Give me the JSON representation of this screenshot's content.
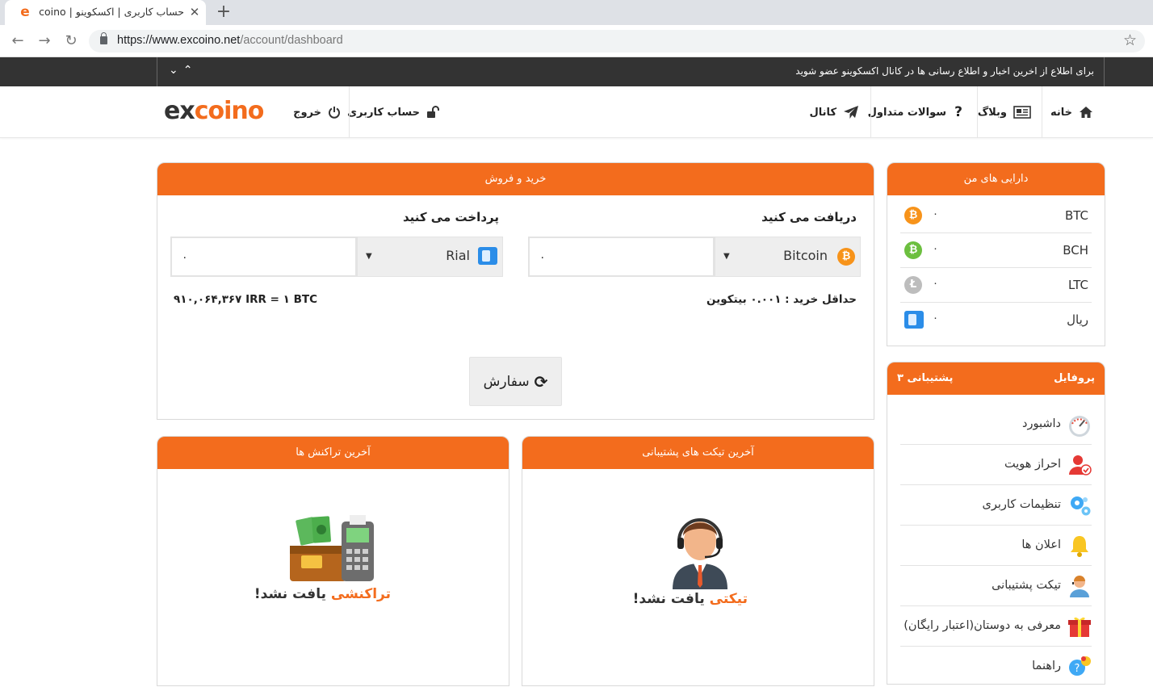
{
  "browser": {
    "tab_title": "حساب کاربری | اکسکوینو | excoino",
    "favicon": "e",
    "url_host": "https://www.excoino.net",
    "url_path": "/account/dashboard"
  },
  "notice": {
    "text": "برای اطلاع از اخرین اخبار و اطلاع رسانی ها در کانال اکسکوینو عضو شوید"
  },
  "nav": {
    "home": "خانه",
    "blog": "وبلاگ",
    "faq": "سوالات متداول",
    "channel": "کانال",
    "account": "حساب کاربری",
    "logout": "خروج",
    "logo_ex": "ex",
    "logo_coin": "coino"
  },
  "trade": {
    "title": "خرید و فروش",
    "receive_title": "دریافت می کنید",
    "pay_title": "پرداخت می کنید",
    "receive_amount": "۰",
    "pay_amount": "۰",
    "receive_currency": "Bitcoin",
    "pay_currency": "Rial",
    "min_purchase": "حداقل خرید : ۰.۰۰۱ بیتکوین",
    "rate": "۹۱۰,۰۶۴,۳۶۷ IRR = ۱ BTC",
    "order_button": "سفارش"
  },
  "assets": {
    "title": "دارایی های من",
    "items": [
      {
        "symbol": "BTC",
        "value": "۰",
        "color": "#f7931a",
        "glyph": "₿"
      },
      {
        "symbol": "BCH",
        "value": "۰",
        "color": "#6cbf3f",
        "glyph": "₿"
      },
      {
        "symbol": "LTC",
        "value": "۰",
        "color": "#bdbdbd",
        "glyph": "Ł"
      },
      {
        "symbol": "ریال",
        "value": "۰",
        "color": "#2b8de8",
        "glyph": ""
      }
    ]
  },
  "profile": {
    "title": "پروفایل",
    "support_label": "پشتیبانی ۳",
    "items": [
      {
        "label": "داشبورد",
        "icon": "dashboard-gauge-icon"
      },
      {
        "label": "احراز هویت",
        "icon": "user-verify-icon"
      },
      {
        "label": "تنظیمات کاربری",
        "icon": "gears-icon"
      },
      {
        "label": "اعلان ها",
        "icon": "bell-icon"
      },
      {
        "label": "تیکت پشتیبانی",
        "icon": "support-agent-icon"
      },
      {
        "label": "معرفی به دوستان(اعتبار رایگان)",
        "icon": "gift-icon"
      },
      {
        "label": "راهنما",
        "icon": "help-phone-icon"
      }
    ]
  },
  "transactions": {
    "title": "آخرین تراکنش ها",
    "empty_highlight": "تراکنشی",
    "empty_rest": " یافت نشد!"
  },
  "tickets": {
    "title": "آخرین تیکت های پشتیبانی",
    "empty_highlight": "تیکتی",
    "empty_rest": " یافت نشد!"
  }
}
